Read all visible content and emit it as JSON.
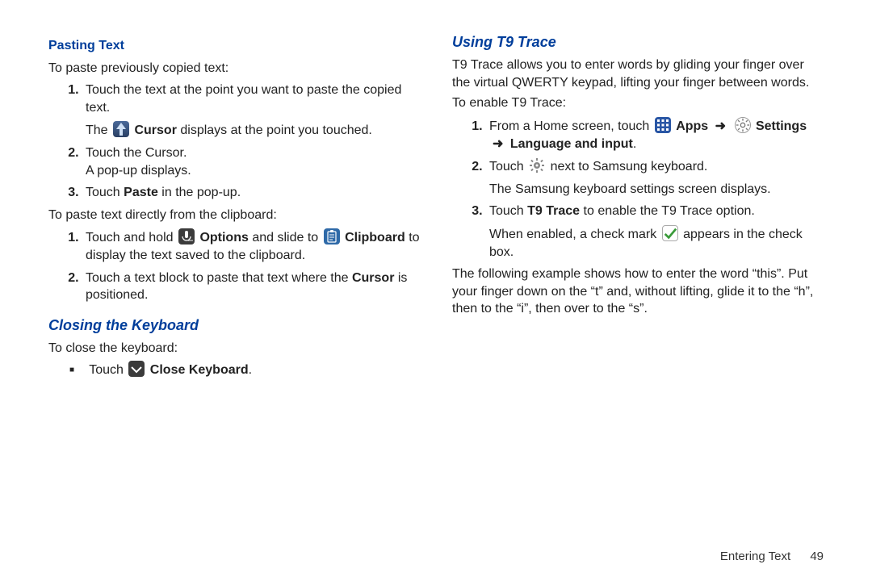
{
  "left": {
    "h_pasting": "Pasting Text",
    "p1": "To paste previously copied text:",
    "s1_a": "Touch the text at the point you want to paste the copied text.",
    "s1_b1": "The ",
    "s1_b2_bold": "Cursor",
    "s1_b3": " displays at the point you touched.",
    "s2_a": "Touch the Cursor.",
    "s2_b": "A pop-up displays.",
    "s3_a": "Touch ",
    "s3_b_bold": "Paste",
    "s3_c": " in the pop-up.",
    "p2": "To paste text directly from the clipboard:",
    "c1_a": "Touch and hold ",
    "c1_b_bold": "Options",
    "c1_c": " and slide to ",
    "c1_d_bold": "Clipboard",
    "c1_e": " to display the text saved to the clipboard.",
    "c2_a": "Touch a text block to paste that text where the ",
    "c2_b_bold": "Cursor",
    "c2_c": " is positioned.",
    "h_closing": "Closing the Keyboard",
    "close_p": "To close the keyboard:",
    "close_b1": "Touch ",
    "close_b2_bold": "Close Keyboard",
    "close_b3": "."
  },
  "right": {
    "h_t9": "Using T9 Trace",
    "p1": "T9 Trace allows you to enter words by gliding your finger over the virtual QWERTY keypad, lifting your finger between words.",
    "p2": "To enable T9 Trace:",
    "s1_a": "From a Home screen, touch ",
    "s1_apps": "Apps",
    "s1_settings": "Settings",
    "s1_lang": "Language and input",
    "s1_dot": ".",
    "s2_a": "Touch ",
    "s2_b": " next to Samsung keyboard.",
    "s2_c": "The Samsung keyboard settings screen displays.",
    "s3_a": "Touch ",
    "s3_b_bold": "T9 Trace",
    "s3_c": " to enable the T9 Trace option.",
    "s3_d": "When enabled, a check mark ",
    "s3_e": " appears in the check box.",
    "p3": "The following example shows how to enter the word “this”. Put your finger down on the “t” and, without lifting, glide it to the “h”, then to the “i”, then over to the “s”."
  },
  "footer": {
    "section": "Entering Text",
    "page": "49"
  },
  "arrow": "➜"
}
